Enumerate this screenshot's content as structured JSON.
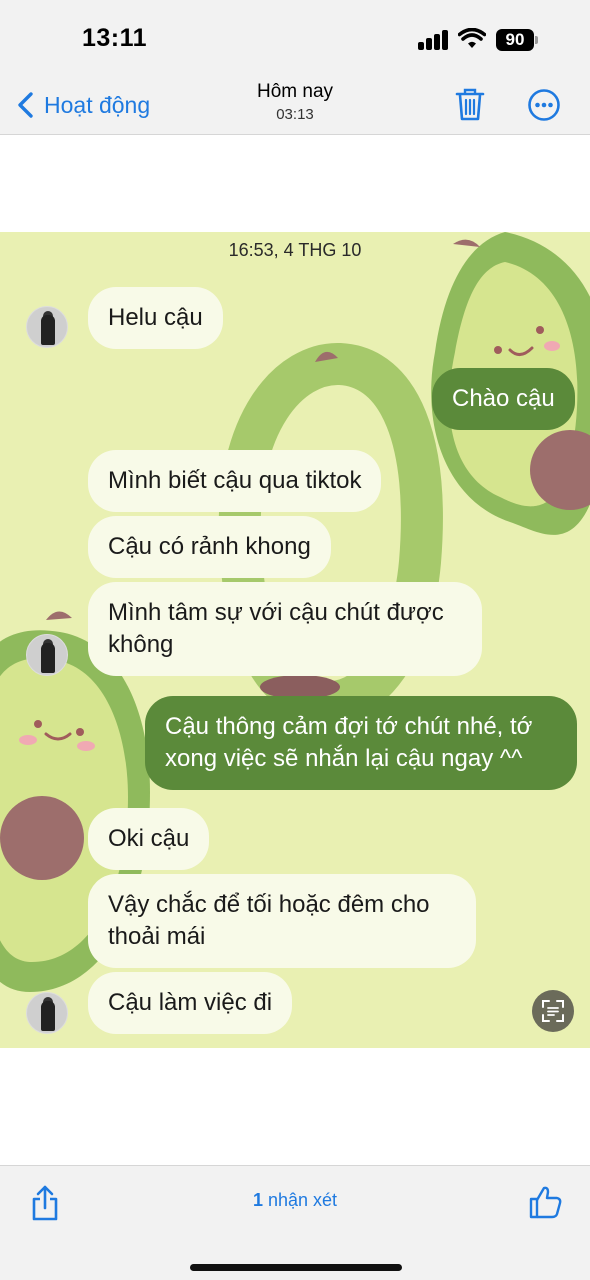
{
  "status_bar": {
    "time": "13:11",
    "battery": "90"
  },
  "nav": {
    "back_label": "Hoạt động",
    "title": "Hôm nay",
    "subtitle": "03:13",
    "icons": {
      "back": "chevron-left-icon",
      "trash": "trash-icon",
      "more": "more-circle-icon"
    }
  },
  "chat": {
    "timestamp": "16:53, 4 THG 10",
    "messages": [
      {
        "from": "them",
        "text": "Helu cậu"
      },
      {
        "from": "me",
        "text": "Chào cậu"
      },
      {
        "from": "them",
        "text": "Mình biết cậu qua tiktok"
      },
      {
        "from": "them",
        "text": "Cậu có rảnh khong"
      },
      {
        "from": "them",
        "line1": "Mình tâm sự với cậu chút được",
        "line2": "không"
      },
      {
        "from": "me",
        "line1": "Cậu thông cảm đợi tớ chút nhé, tớ",
        "line2": "xong việc sẽ nhắn lại cậu ngay ^^"
      },
      {
        "from": "them",
        "text": "Oki cậu"
      },
      {
        "from": "them",
        "line1": "Vậy chắc để tối hoặc đêm cho",
        "line2": "thoải mái"
      },
      {
        "from": "them",
        "text": "Cậu làm việc đi"
      }
    ],
    "colors": {
      "background": "#e9f0b2",
      "incoming": "#f8fae8",
      "outgoing": "#5b8a3a"
    }
  },
  "bottom_bar": {
    "comment_count": "1",
    "comment_label": "nhận xét",
    "icons": {
      "share": "share-icon",
      "like": "thumbs-up-icon"
    }
  },
  "accent_color": "#1f7ae0"
}
